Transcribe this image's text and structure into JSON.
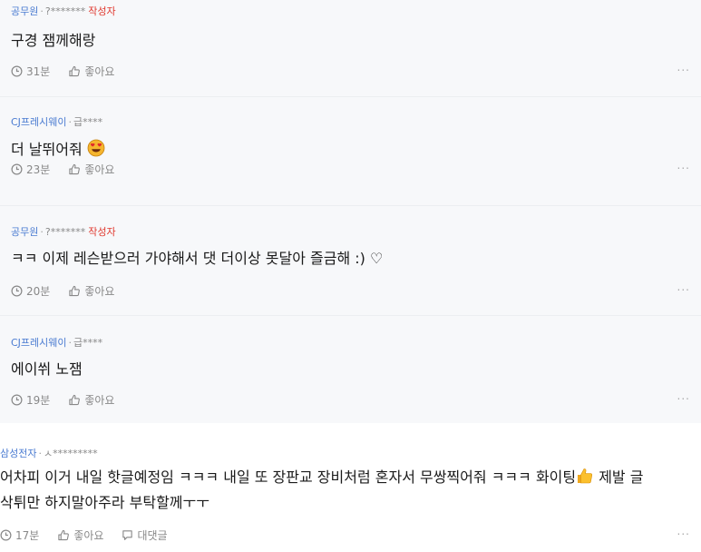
{
  "comments": [
    {
      "company": "공무원",
      "user": "?*******",
      "badge": "작성자",
      "text": "구경 잼께해랑",
      "time": "31분",
      "like": "좋아요",
      "more": "..."
    },
    {
      "company": "CJ프레시웨이",
      "user": "급****",
      "text": "더 날뛰어줘",
      "emoji": "heart-eyes",
      "time": "23분",
      "like": "좋아요",
      "more": "..."
    },
    {
      "company": "공무원",
      "user": "?*******",
      "badge": "작성자",
      "text": "ㅋㅋ 이제 레슨받으러 가야해서 댓 더이상 못달아 즐금해 :) ♡",
      "time": "20분",
      "like": "좋아요",
      "more": "..."
    },
    {
      "company": "CJ프레시웨이",
      "user": "급****",
      "text": "에이쒸 노잼",
      "time": "19분",
      "like": "좋아요",
      "more": "..."
    },
    {
      "company": "삼성전자",
      "user": "ㅅ*********",
      "text_line1": "어차피 이거 내일 핫글예정임 ㅋㅋㅋ 내일 또 장판교 장비처럼 혼자서 무쌍찍어줘 ㅋㅋㅋ 화이팅",
      "text_line1_end": " 제발 글",
      "text_line2": "삭튀만 하지말아주라 부탁할께ㅜㅜ",
      "time": "17분",
      "like": "좋아요",
      "reply": "대댓글",
      "more": "..."
    }
  ],
  "colors": {
    "reply_bg": "#f7f8fa",
    "company": "#4a7bd1",
    "author_badge": "#e0392f"
  }
}
